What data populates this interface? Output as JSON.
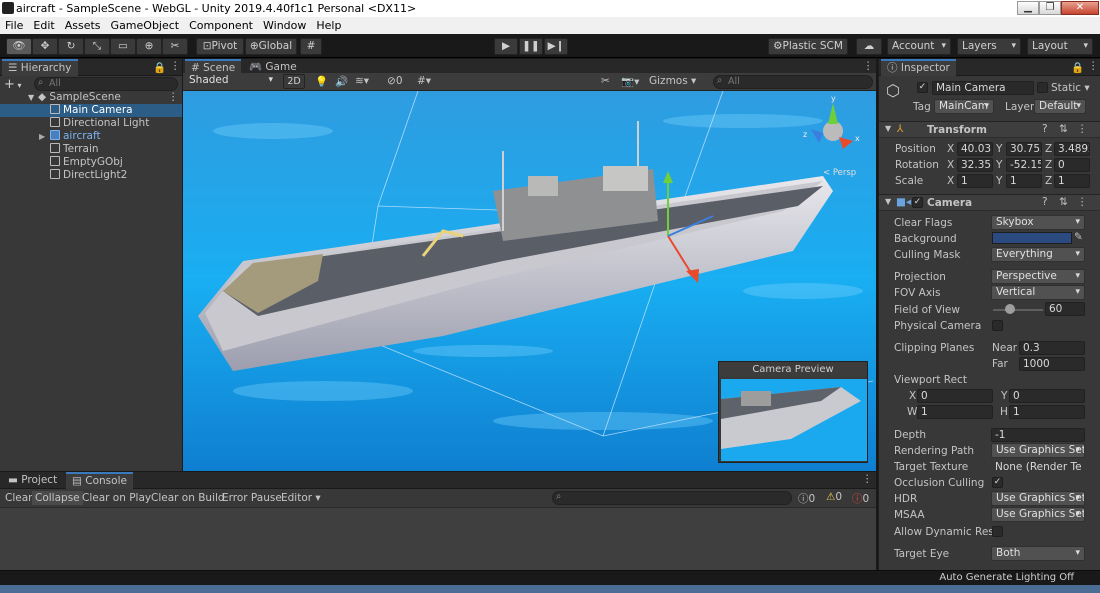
{
  "window": {
    "title": "aircraft - SampleScene - WebGL - Unity 2019.4.40f1c1 Personal <DX11>"
  },
  "menu": [
    "File",
    "Edit",
    "Assets",
    "GameObject",
    "Component",
    "Window",
    "Help"
  ],
  "toolbar": {
    "pivot": "Pivot",
    "global": "Global",
    "plastic": "Plastic SCM",
    "account": "Account",
    "layers": "Layers",
    "layout": "Layout"
  },
  "hierarchy": {
    "tab": "Hierarchy",
    "add": "+",
    "search_placeholder": "All",
    "scene": "SampleScene",
    "items": [
      "Main Camera",
      "Directional Light",
      "aircraft",
      "Terrain",
      "EmptyGObj",
      "DirectLight2"
    ]
  },
  "scene": {
    "tab_scene": "Scene",
    "tab_game": "Game",
    "shading": "Shaded",
    "mode_2d": "2D",
    "fx_count": "0",
    "gizmos": "Gizmos",
    "search_placeholder": "All",
    "persp_label": "< Persp",
    "camera_preview": "Camera Preview"
  },
  "console": {
    "tab_project": "Project",
    "tab_console": "Console",
    "buttons": [
      "Clear",
      "Collapse",
      "Clear on Play",
      "Clear on Build",
      "Error Pause",
      "Editor"
    ],
    "count_info": "0",
    "count_warn": "0",
    "count_error": "0"
  },
  "inspector": {
    "tab": "Inspector",
    "name": "Main Camera",
    "static": "Static",
    "tag_label": "Tag",
    "tag": "MainCam",
    "layer_label": "Layer",
    "layer": "Default",
    "transform": {
      "title": "Transform",
      "position_label": "Position",
      "rotation_label": "Rotation",
      "scale_label": "Scale",
      "position": [
        "40.03",
        "30.755",
        "3.4892"
      ],
      "rotation": [
        "32.35",
        "-52.15",
        "0"
      ],
      "scale": [
        "1",
        "1",
        "1"
      ]
    },
    "camera": {
      "title": "Camera",
      "clear_flags_label": "Clear Flags",
      "clear_flags": "Skybox",
      "background_label": "Background",
      "background_color": "#2a4a80",
      "culling_mask_label": "Culling Mask",
      "culling_mask": "Everything",
      "projection_label": "Projection",
      "projection": "Perspective",
      "fov_axis_label": "FOV Axis",
      "fov_axis": "Vertical",
      "fov_label": "Field of View",
      "fov": "60",
      "fov_slider_fraction": 0.33,
      "physical_label": "Physical Camera",
      "clipping_label": "Clipping Planes",
      "near_label": "Near",
      "near": "0.3",
      "far_label": "Far",
      "far": "1000",
      "viewport_label": "Viewport Rect",
      "vx": "0",
      "vy": "0",
      "vw": "1",
      "vh": "1",
      "depth_label": "Depth",
      "depth": "-1",
      "render_path_label": "Rendering Path",
      "render_path": "Use Graphics Set",
      "target_texture_label": "Target Texture",
      "target_texture": "None (Render Te",
      "occlusion_label": "Occlusion Culling",
      "hdr_label": "HDR",
      "hdr": "Use Graphics Set",
      "msaa_label": "MSAA",
      "msaa": "Use Graphics Set",
      "dyn_res_label": "Allow Dynamic Resol",
      "target_eye_label": "Target Eye",
      "target_eye": "Both"
    }
  },
  "status": {
    "lighting": "Auto Generate Lighting Off"
  }
}
